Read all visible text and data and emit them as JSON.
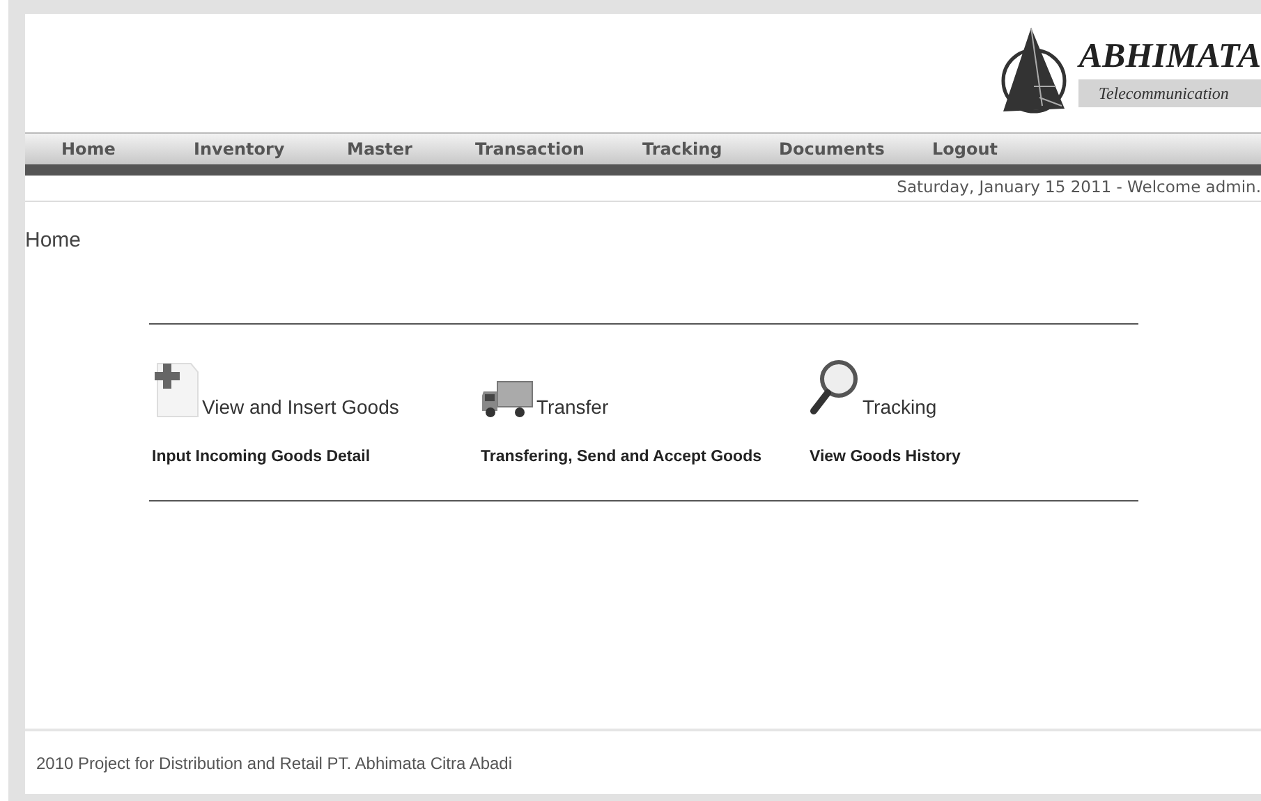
{
  "logo": {
    "name": "ABHIMATA",
    "tagline": "Telecommunication"
  },
  "nav": [
    {
      "label": "Home"
    },
    {
      "label": "Inventory"
    },
    {
      "label": "Master"
    },
    {
      "label": "Transaction"
    },
    {
      "label": "Tracking"
    },
    {
      "label": "Documents"
    },
    {
      "label": "Logout"
    }
  ],
  "status_line": "Saturday, January 15 2011 - Welcome admin.",
  "page_title": "Home",
  "features": [
    {
      "kind": "insert",
      "title": "View and Insert Goods",
      "description": "Input Incoming Goods Detail"
    },
    {
      "kind": "transfer",
      "title": "Transfer",
      "description": "Transfering, Send and Accept Goods"
    },
    {
      "kind": "tracking",
      "title": "Tracking",
      "description": "View Goods History"
    }
  ],
  "footer": "2010 Project for Distribution and Retail PT. Abhimata Citra Abadi"
}
